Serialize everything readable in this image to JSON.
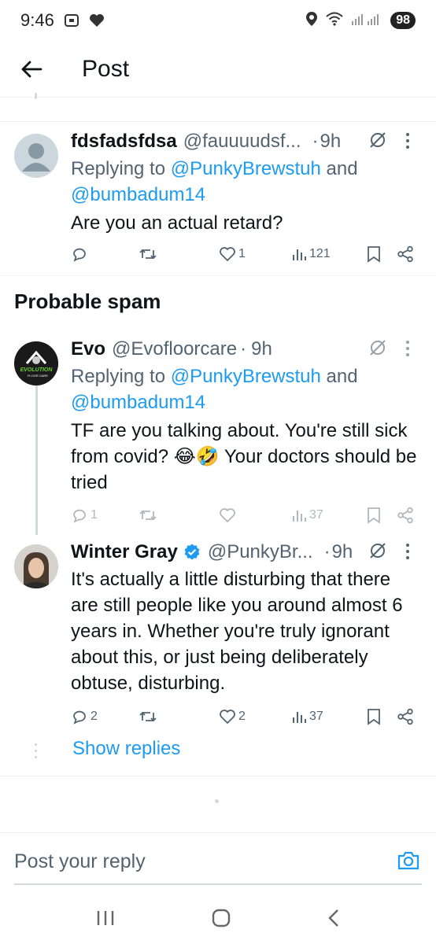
{
  "status_bar": {
    "time": "9:46",
    "battery": "98"
  },
  "header": {
    "title": "Post"
  },
  "clipped": {
    "show_replies": "Show replies"
  },
  "tweets": [
    {
      "name": "fdsfadsfdsa",
      "handle": "@fauuuudsf...",
      "sep": "·",
      "time": "9h",
      "reply_prefix": "Replying to ",
      "reply_user1": "@PunkyBrewstuh",
      "reply_and": " and",
      "reply_user2": "@bumbadum14",
      "text": "Are you an actual retard?",
      "replies": "",
      "retweets": "",
      "likes": "1",
      "views": "121"
    },
    {
      "name": "Evo",
      "handle": "@Evofloorcare",
      "sep": "·",
      "time": "9h",
      "reply_prefix": "Replying to ",
      "reply_user1": "@PunkyBrewstuh",
      "reply_and": " and",
      "reply_user2": "@bumbadum14",
      "text": "TF are you talking about. You're still sick from covid? 😂🤣 Your doctors should be tried",
      "replies": "1",
      "retweets": "",
      "likes": "",
      "views": "37",
      "avatar_text1": "EVOLUTION",
      "avatar_text2": "FLOOR CARE"
    },
    {
      "name": "Winter Gray",
      "handle": "@PunkyBr...",
      "sep": "·",
      "time": "9h",
      "text": "It's actually a little disturbing that there are still people like you around almost 6 years in. Whether you're truly ignorant about this, or just being deliberately obtuse, disturbing.",
      "replies": "2",
      "retweets": "",
      "likes": "2",
      "views": "37"
    }
  ],
  "section": {
    "probable_spam": "Probable spam"
  },
  "thread": {
    "show_replies": "Show replies"
  },
  "reply_bar": {
    "placeholder": "Post your reply"
  },
  "colors": {
    "accent": "#1d9bf0",
    "verified": "#1d9bf0",
    "secondary_text": "#536471",
    "primary_text": "#0f1419"
  }
}
